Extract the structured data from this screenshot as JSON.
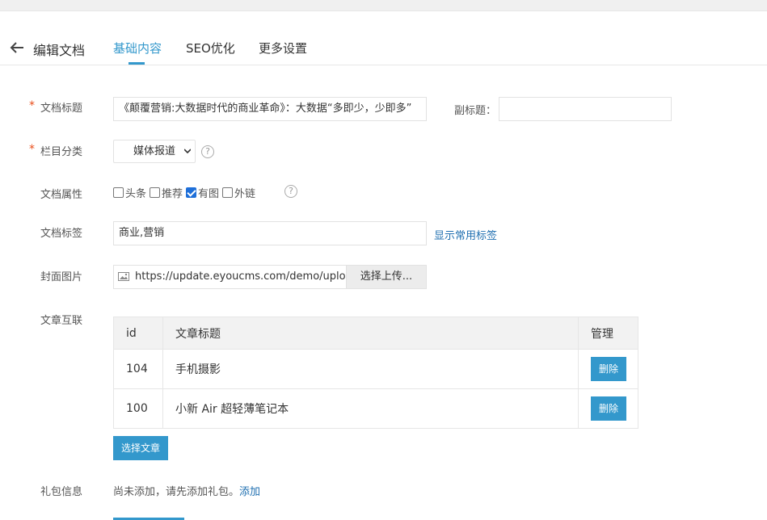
{
  "header": {
    "title": "编辑文档",
    "tabs": [
      {
        "label": "基础内容"
      },
      {
        "label": "SEO优化"
      },
      {
        "label": "更多设置"
      }
    ]
  },
  "form": {
    "doc_title": {
      "label": "文档标题",
      "required": "*",
      "value": "《颠覆营销:大数据时代的商业革命》：大数据“多即少，少即多”"
    },
    "subtitle": {
      "label": "副标题：",
      "value": ""
    },
    "category": {
      "label": "栏目分类",
      "required": "*",
      "value": "媒体报道"
    },
    "attributes": {
      "label": "文档属性",
      "options": [
        {
          "label": "头条",
          "checked": false
        },
        {
          "label": "推荐",
          "checked": false
        },
        {
          "label": "有图",
          "checked": true
        },
        {
          "label": "外链",
          "checked": false
        }
      ]
    },
    "tags": {
      "label": "文档标签",
      "value": "商业,营销",
      "link": "显示常用标签"
    },
    "cover": {
      "label": "封面图片",
      "value": "https://update.eyoucms.com/demo/uploa",
      "button": "选择上传..."
    },
    "related": {
      "label": "文章互联",
      "columns": [
        "id",
        "文章标题",
        "管理"
      ],
      "rows": [
        {
          "id": "104",
          "title": "手机摄影",
          "action": "删除"
        },
        {
          "id": "100",
          "title": "小新 Air 超轻薄笔记本",
          "action": "删除"
        }
      ],
      "select_button": "选择文章"
    },
    "gift": {
      "label": "礼包信息",
      "text": "尚未添加，请先添加礼包。",
      "link": "添加"
    }
  },
  "help_glyph": "?",
  "colors": {
    "accent": "#3398cc",
    "required": "#e94e1b",
    "link": "#1f6fb0"
  }
}
